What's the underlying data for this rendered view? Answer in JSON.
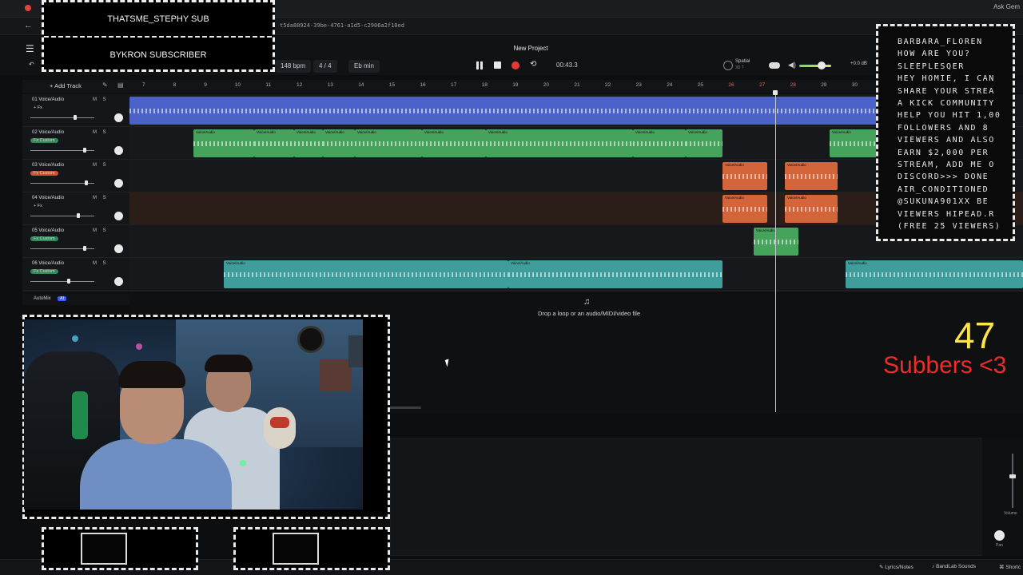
{
  "browser": {
    "url": "t5da88924-39be-4761-a1d5-c2906a2f10ed",
    "ask_label": "Ask Gem"
  },
  "app": {
    "project_title": "New Project"
  },
  "transport": {
    "tempo": "148 bpm",
    "time_signature": "4 / 4",
    "key": "Eb min",
    "time": "00:43.3",
    "spatial_label": "Spatial",
    "spatial_sub": "3D ?",
    "master_db": "+0.0 dB",
    "volume_level": 0.7
  },
  "tracks_header": {
    "add_track_label": "Add Track"
  },
  "tracks": [
    {
      "name": "01 Voice/Audio",
      "fx": "+ Fx",
      "fx_style": "plain",
      "slider": 0.7
    },
    {
      "name": "02 Voice/Audio",
      "fx": "Fx Custom",
      "fx_style": "green",
      "slider": 0.85
    },
    {
      "name": "03 Voice/Audio",
      "fx": "Fx Custom",
      "fx_style": "orange",
      "slider": 0.88
    },
    {
      "name": "04 Voice/Audio",
      "fx": "+ Fx",
      "fx_style": "plain",
      "slider": 0.75
    },
    {
      "name": "05 Voice/Audio",
      "fx": "Fx Custom",
      "fx_style": "green",
      "slider": 0.85
    },
    {
      "name": "06 Voice/Audio",
      "fx": "Fx Custom",
      "fx_style": "green",
      "slider": 0.6
    }
  ],
  "track_controls": {
    "ms": "M S"
  },
  "ruler": {
    "bars": [
      "7",
      "8",
      "9",
      "10",
      "11",
      "12",
      "13",
      "14",
      "15",
      "16",
      "17",
      "18",
      "19",
      "20",
      "21",
      "22",
      "23",
      "24",
      "25",
      "26",
      "27",
      "28",
      "29",
      "30"
    ]
  },
  "clip_label": "Voice/Audio",
  "automix": {
    "label": "AutoMix",
    "badge": "AI"
  },
  "drop_zone": {
    "text": "Drop a loop or an audio/MIDI/video file"
  },
  "mixer": {
    "volume_label": "Volume",
    "pan_label": "Pan"
  },
  "bottom_bar": {
    "lyrics": "Lyrics/Notes",
    "sounds": "BandLab Sounds",
    "shortcuts": "Shortc"
  },
  "overlay": {
    "sub_line1": "THATSME_STEPHY SUB",
    "sub_line2": "BYKRON SUBSCRIBER",
    "sub_count": "47",
    "sub_text": "Subbers <3",
    "chat": [
      "BARBARA_FLOREN",
      "HOW ARE YOU?",
      "SLEEPLESQER",
      "HEY HOMIE, I CAN",
      "SHARE YOUR STREA",
      "A KICK COMMUNITY",
      "HELP YOU HIT 1,00",
      "FOLLOWERS AND 8",
      "VIEWERS AND ALSO",
      "EARN $2,000 PER",
      "STREAM, ADD ME O",
      "DISCORD>>> DONE",
      "AIR_CONDITIONED",
      "@SUKUNA901XX BE",
      "VIEWERS HIPEAD.R",
      "(FREE 25 VIEWERS)"
    ]
  },
  "colors": {
    "accent_blue": "#4b63c8",
    "accent_green": "#46a35c",
    "accent_orange": "#d4643a",
    "accent_teal": "#3f9d9c",
    "record_red": "#e53935",
    "count_yellow": "#ffe34a",
    "count_red": "#ef2b2b"
  }
}
